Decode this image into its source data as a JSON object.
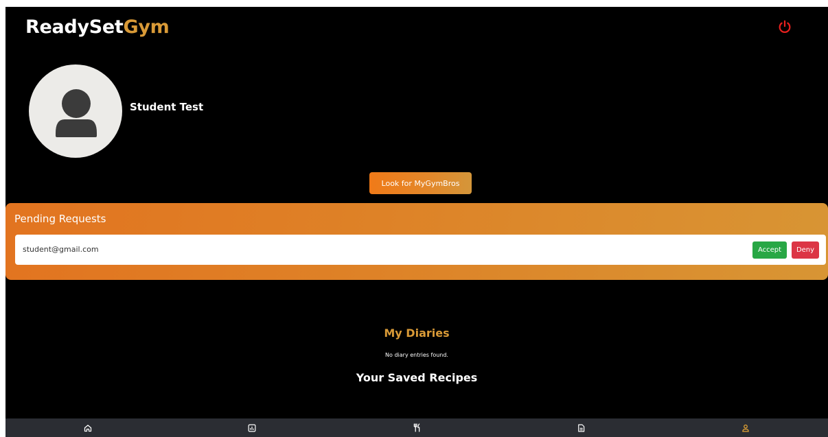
{
  "header": {
    "brand_primary": "ReadySet",
    "brand_accent": "Gym",
    "power_icon": "power-icon"
  },
  "profile": {
    "avatar_icon": "user-avatar-icon",
    "name": "Student Test"
  },
  "actions": {
    "look_label": "Look for MyGymBros"
  },
  "pending": {
    "title": "Pending Requests",
    "requests": [
      {
        "email": "student@gmail.com",
        "accept_label": "Accept",
        "deny_label": "Deny"
      }
    ]
  },
  "diaries": {
    "title": "My Diaries",
    "empty_text": "No diary entries found."
  },
  "recipes": {
    "title": "Your Saved Recipes"
  },
  "nav": {
    "items": [
      {
        "icon": "home-icon",
        "active": false
      },
      {
        "icon": "chart-icon",
        "active": false
      },
      {
        "icon": "utensils-icon",
        "active": false
      },
      {
        "icon": "document-icon",
        "active": false
      },
      {
        "icon": "profile-icon",
        "active": true
      }
    ]
  },
  "colors": {
    "accent": "#d99a37",
    "power": "#e8201e",
    "accept": "#28a745",
    "deny": "#dc3545",
    "nav_bg": "#2b2d33",
    "nav_icon": "#ffffff",
    "nav_active": "#e6a535"
  }
}
